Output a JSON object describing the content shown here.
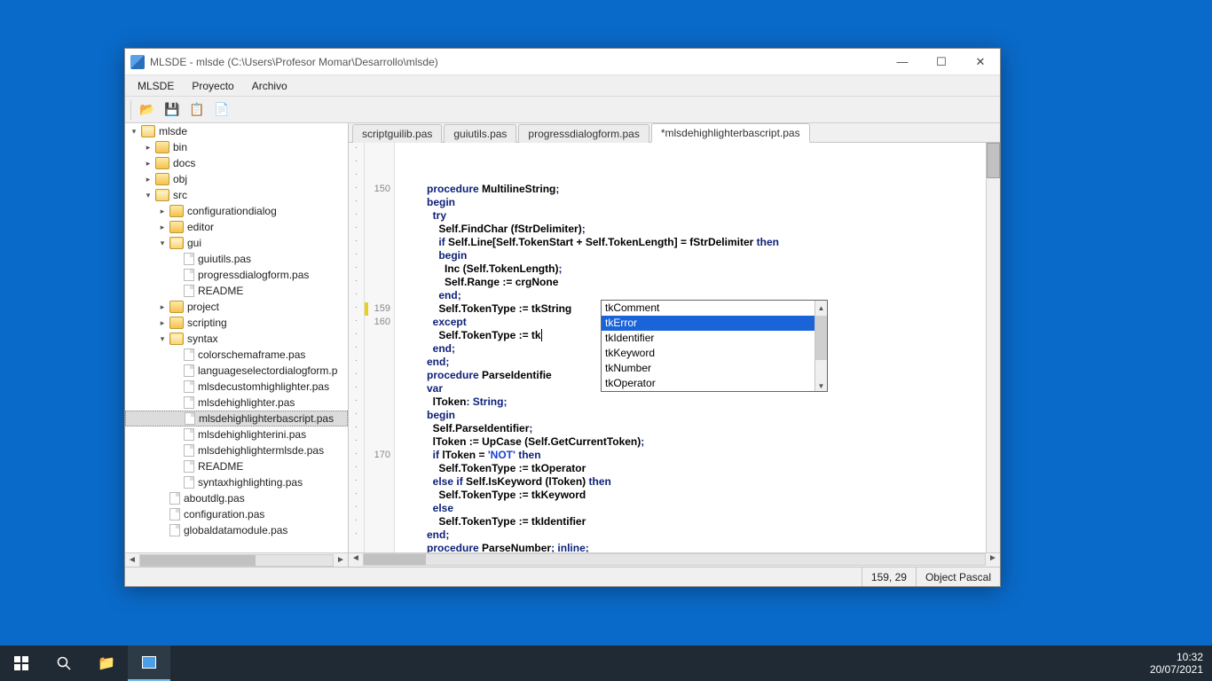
{
  "window": {
    "title": "MLSDE - mlsde (C:\\Users\\Profesor Momar\\Desarrollo\\mlsde)"
  },
  "menu": {
    "items": [
      "MLSDE",
      "Proyecto",
      "Archivo"
    ]
  },
  "toolbar": {
    "icons": [
      "open-icon",
      "save-icon",
      "copy-icon",
      "close-icon"
    ]
  },
  "tree": {
    "rows": [
      {
        "depth": 0,
        "twisty": "▾",
        "type": "folder",
        "open": true,
        "label": "mlsde"
      },
      {
        "depth": 1,
        "twisty": "▸",
        "type": "folder",
        "open": false,
        "label": "bin"
      },
      {
        "depth": 1,
        "twisty": "▸",
        "type": "folder",
        "open": false,
        "label": "docs"
      },
      {
        "depth": 1,
        "twisty": "▸",
        "type": "folder",
        "open": false,
        "label": "obj"
      },
      {
        "depth": 1,
        "twisty": "▾",
        "type": "folder",
        "open": true,
        "label": "src"
      },
      {
        "depth": 2,
        "twisty": "▸",
        "type": "folder",
        "open": false,
        "label": "configurationdialog"
      },
      {
        "depth": 2,
        "twisty": "▸",
        "type": "folder",
        "open": false,
        "label": "editor"
      },
      {
        "depth": 2,
        "twisty": "▾",
        "type": "folder",
        "open": true,
        "label": "gui"
      },
      {
        "depth": 3,
        "twisty": "",
        "type": "file",
        "label": "guiutils.pas"
      },
      {
        "depth": 3,
        "twisty": "",
        "type": "file",
        "label": "progressdialogform.pas"
      },
      {
        "depth": 3,
        "twisty": "",
        "type": "file",
        "label": "README"
      },
      {
        "depth": 2,
        "twisty": "▸",
        "type": "folder",
        "open": false,
        "label": "project"
      },
      {
        "depth": 2,
        "twisty": "▸",
        "type": "folder",
        "open": false,
        "label": "scripting"
      },
      {
        "depth": 2,
        "twisty": "▾",
        "type": "folder",
        "open": true,
        "label": "syntax"
      },
      {
        "depth": 3,
        "twisty": "",
        "type": "file",
        "label": "colorschemaframe.pas"
      },
      {
        "depth": 3,
        "twisty": "",
        "type": "file",
        "label": "languageselectordialogform.p"
      },
      {
        "depth": 3,
        "twisty": "",
        "type": "file",
        "label": "mlsdecustomhighlighter.pas"
      },
      {
        "depth": 3,
        "twisty": "",
        "type": "file",
        "label": "mlsdehighlighter.pas"
      },
      {
        "depth": 3,
        "twisty": "",
        "type": "file",
        "label": "mlsdehighlighterbascript.pas",
        "selected": true
      },
      {
        "depth": 3,
        "twisty": "",
        "type": "file",
        "label": "mlsdehighlighterini.pas"
      },
      {
        "depth": 3,
        "twisty": "",
        "type": "file",
        "label": "mlsdehighlightermlsde.pas"
      },
      {
        "depth": 3,
        "twisty": "",
        "type": "file",
        "label": "README"
      },
      {
        "depth": 3,
        "twisty": "",
        "type": "file",
        "label": "syntaxhighlighting.pas"
      },
      {
        "depth": 2,
        "twisty": "",
        "type": "file",
        "label": "aboutdlg.pas"
      },
      {
        "depth": 2,
        "twisty": "",
        "type": "file",
        "label": "configuration.pas"
      },
      {
        "depth": 2,
        "twisty": "",
        "type": "file",
        "label": "globaldatamodule.pas"
      }
    ]
  },
  "tabs": {
    "items": [
      {
        "label": "scriptguilib.pas",
        "active": false
      },
      {
        "label": "guiutils.pas",
        "active": false
      },
      {
        "label": "progressdialogform.pas",
        "active": false
      },
      {
        "label": "*mlsdehighlighterbascript.pas",
        "active": true
      }
    ]
  },
  "gutter": {
    "visible": {
      "150": 3,
      "159": 12,
      "160": 13,
      "170": 23
    },
    "mark_index": 12,
    "line_count": 30
  },
  "code": {
    "lines": [
      [
        [
          "kw",
          "procedure"
        ],
        [
          "id",
          " MultilineString"
        ],
        [
          "kw",
          ";"
        ]
      ],
      [
        [
          "kw",
          "begin"
        ]
      ],
      [
        [
          "id",
          "  "
        ],
        [
          "kw",
          "try"
        ]
      ],
      [
        [
          "id",
          "    Self.FindChar (fStrDelimiter)"
        ],
        [
          "kw",
          ";"
        ]
      ],
      [
        [
          "id",
          "    "
        ],
        [
          "kw",
          "if"
        ],
        [
          "id",
          " Self.Line[Self.TokenStart + Self.TokenLength] = fStrDelimiter "
        ],
        [
          "kw",
          "then"
        ]
      ],
      [
        [
          "id",
          "    "
        ],
        [
          "kw",
          "begin"
        ]
      ],
      [
        [
          "id",
          "      Inc (Self.TokenLength)"
        ],
        [
          "kw",
          ";"
        ]
      ],
      [
        [
          "id",
          "      Self.Range := crgNone"
        ]
      ],
      [
        [
          "id",
          "    "
        ],
        [
          "kw",
          "end"
        ],
        [
          "kw",
          ";"
        ]
      ],
      [
        [
          "id",
          "    Self.TokenType := tkString"
        ]
      ],
      [
        [
          "id",
          "  "
        ],
        [
          "kw",
          "except"
        ]
      ],
      [
        [
          "id",
          "    Self.TokenType := tk"
        ]
      ],
      [
        [
          "id",
          "  "
        ],
        [
          "kw",
          "end"
        ],
        [
          "kw",
          ";"
        ]
      ],
      [
        [
          "kw",
          "end"
        ],
        [
          "kw",
          ";"
        ]
      ],
      [
        [
          "id",
          ""
        ]
      ],
      [
        [
          "kw",
          "procedure"
        ],
        [
          "id",
          " ParseIdentifie"
        ]
      ],
      [
        [
          "kw",
          "var"
        ]
      ],
      [
        [
          "id",
          "  lToken"
        ],
        [
          "kw",
          ":"
        ],
        [
          "id",
          " "
        ],
        [
          "kw",
          "String"
        ],
        [
          "kw",
          ";"
        ]
      ],
      [
        [
          "kw",
          "begin"
        ]
      ],
      [
        [
          "id",
          "  Self.ParseIdentifier"
        ],
        [
          "kw",
          ";"
        ]
      ],
      [
        [
          "id",
          "  lToken := UpCase (Self.GetCurrentToken)"
        ],
        [
          "kw",
          ";"
        ]
      ],
      [
        [
          "id",
          "  "
        ],
        [
          "kw",
          "if"
        ],
        [
          "id",
          " lToken = "
        ],
        [
          "str",
          "'NOT'"
        ],
        [
          "id",
          " "
        ],
        [
          "kw",
          "then"
        ]
      ],
      [
        [
          "id",
          "    Self.TokenType := tkOperator"
        ]
      ],
      [
        [
          "id",
          "  "
        ],
        [
          "kw",
          "else if"
        ],
        [
          "id",
          " Self.IsKeyword (lToken) "
        ],
        [
          "kw",
          "then"
        ]
      ],
      [
        [
          "id",
          "    Self.TokenType := tkKeyword"
        ]
      ],
      [
        [
          "id",
          "  "
        ],
        [
          "kw",
          "else"
        ]
      ],
      [
        [
          "id",
          "    Self.TokenType := tkIdentifier"
        ]
      ],
      [
        [
          "kw",
          "end"
        ],
        [
          "kw",
          ";"
        ]
      ],
      [
        [
          "id",
          ""
        ]
      ],
      [
        [
          "kw",
          "procedure"
        ],
        [
          "id",
          " ParseNumber"
        ],
        [
          "kw",
          ";"
        ],
        [
          "id",
          " "
        ],
        [
          "kw",
          "inline"
        ],
        [
          "kw",
          ";"
        ]
      ]
    ],
    "caret_line_index": 11
  },
  "completion": {
    "items": [
      "tkComment",
      "tkError",
      "tkIdentifier",
      "tkKeyword",
      "tkNumber",
      "tkOperator"
    ],
    "selected_index": 1
  },
  "status": {
    "cursor": "159, 29",
    "language": "Object Pascal"
  },
  "systray": {
    "time": "10:32",
    "date": "20/07/2021"
  }
}
